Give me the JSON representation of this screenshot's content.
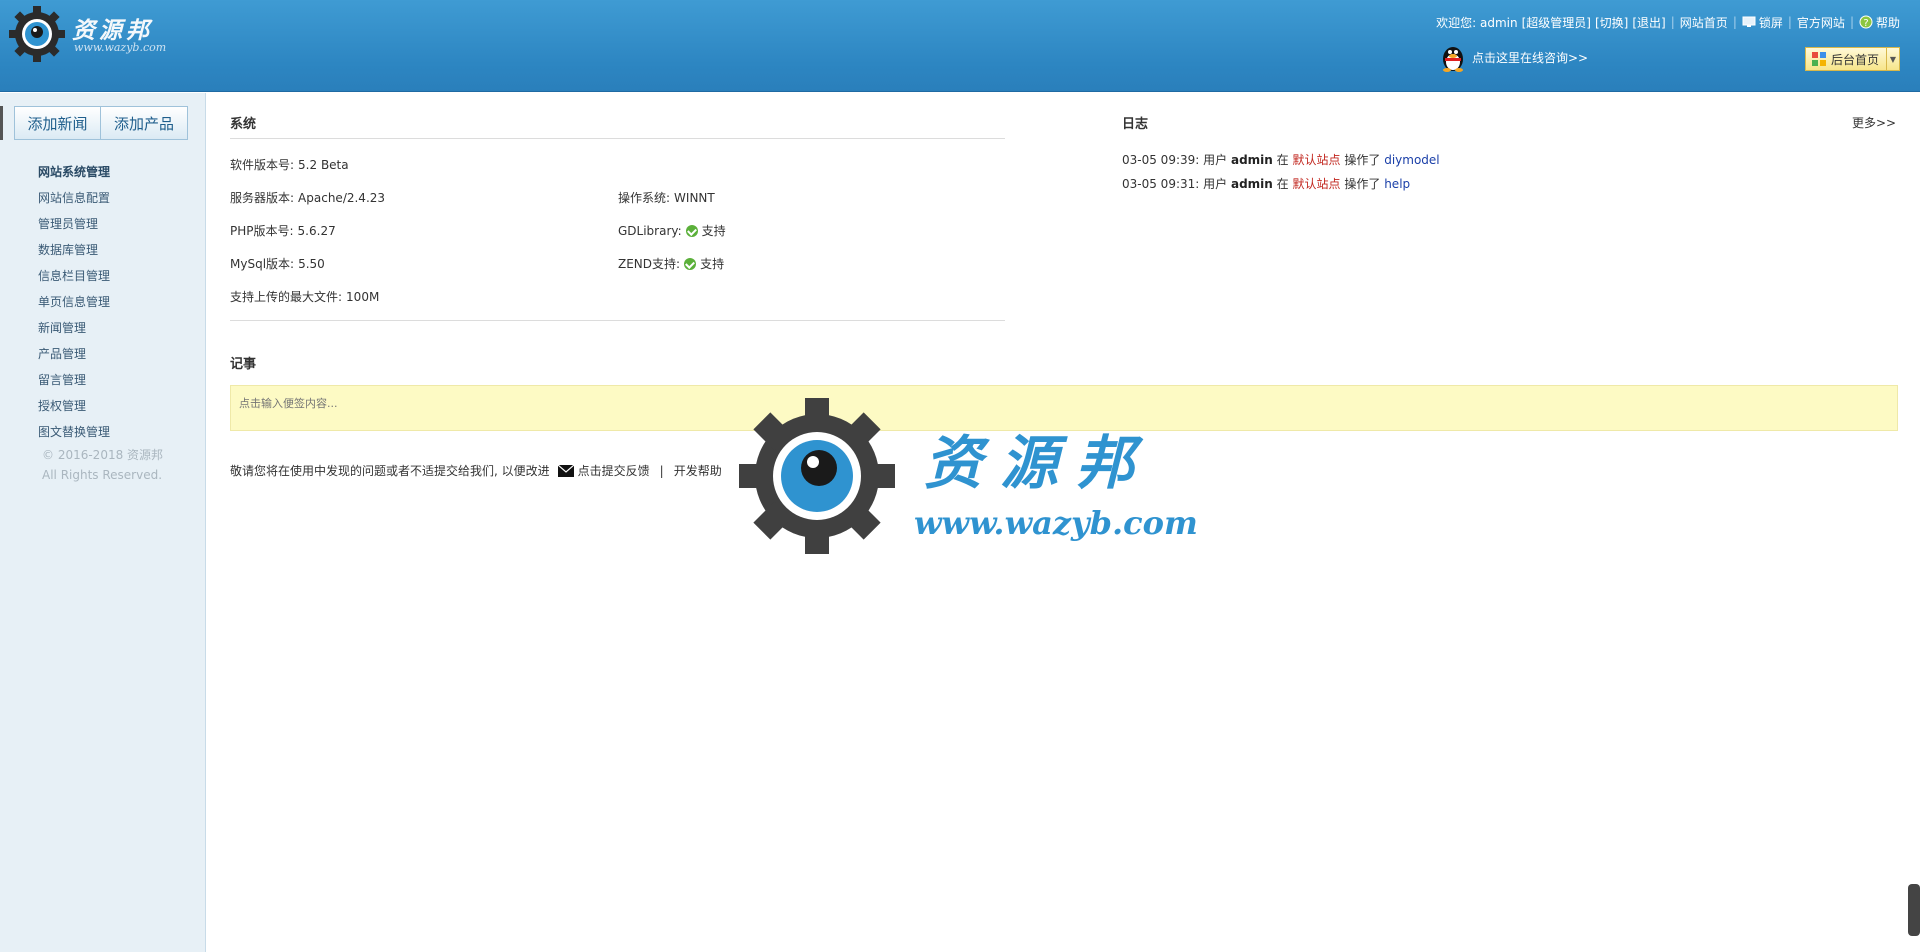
{
  "logo": {
    "name": "资源邦",
    "url": "www.wazyb.com"
  },
  "topbar": {
    "welcome": "欢迎您: admin",
    "role": "[超级管理员]",
    "switch": "[切换]",
    "logout": "[退出]",
    "site_home": "网站首页",
    "lock": "锁屏",
    "official": "官方网站",
    "help": "帮助"
  },
  "consult": {
    "text": "点击这里在线咨询>>"
  },
  "home_button": {
    "label": "后台首页"
  },
  "sidebar": {
    "tabs": [
      "添加新闻",
      "添加产品"
    ],
    "items": [
      "网站系统管理",
      "网站信息配置",
      "管理员管理",
      "数据库管理",
      "信息栏目管理",
      "单页信息管理",
      "新闻管理",
      "产品管理",
      "留言管理",
      "授权管理",
      "图文替换管理"
    ],
    "copyright_line1": "© 2016-2018 资源邦",
    "copyright_line2": "All Rights Reserved."
  },
  "system": {
    "title": "系统",
    "software_label": "软件版本号:",
    "software": "5.2 Beta",
    "server_label": "服务器版本:",
    "server": "Apache/2.4.23",
    "os_label": "操作系统:",
    "os": "WINNT",
    "php_label": "PHP版本号:",
    "php": "5.6.27",
    "gd_label": "GDLibrary:",
    "gd": "支持",
    "mysql_label": "MySql版本:",
    "mysql": "5.50",
    "zend_label": "ZEND支持:",
    "zend": "支持",
    "upload_label": "支持上传的最大文件:",
    "upload": "100M"
  },
  "log": {
    "title": "日志",
    "more": "更多>>",
    "entries": [
      {
        "time": "03-05 09:39:",
        "user_prefix": "用户",
        "user": "admin",
        "at": "在",
        "site": "默认站点",
        "action": "操作了",
        "module": "diymodel"
      },
      {
        "time": "03-05 09:31:",
        "user_prefix": "用户",
        "user": "admin",
        "at": "在",
        "site": "默认站点",
        "action": "操作了",
        "module": "help"
      }
    ]
  },
  "notes": {
    "title": "记事",
    "placeholder": "点击输入便签内容..."
  },
  "feedback": {
    "text": "敬请您将在使用中发现的问题或者不适提交给我们, 以便改进",
    "submit": "点击提交反馈",
    "separator": "|",
    "dev_help": "开发帮助"
  },
  "watermark": {
    "name": "资源邦",
    "url": "www.wazyb.com"
  },
  "colors": {
    "header": "#2d86c2",
    "sidebar": "#e7f0f6",
    "note_bg": "#fdfac4",
    "watermark": "#2f93d0"
  }
}
